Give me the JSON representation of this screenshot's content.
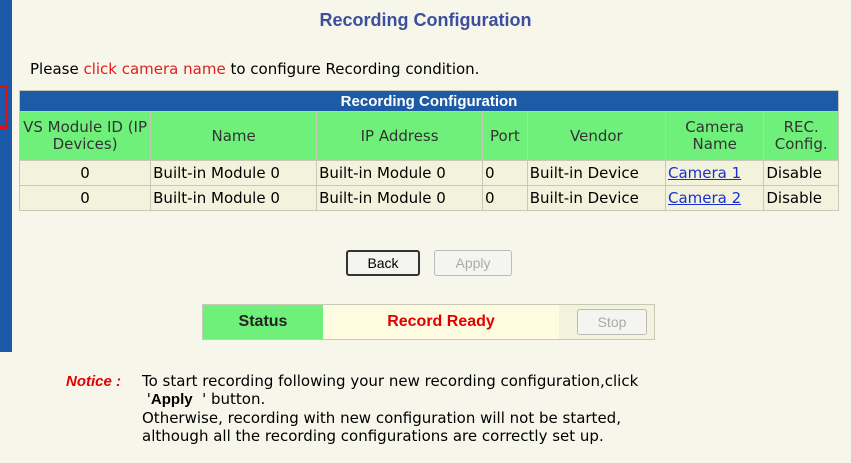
{
  "page": {
    "title": "Recording Configuration",
    "intro_before": "Please ",
    "intro_link": "click camera name",
    "intro_after": " to configure Recording condition."
  },
  "table": {
    "title": "Recording Configuration",
    "headers": [
      "VS Module ID (IP Devices)",
      "Name",
      "IP Address",
      "Port",
      "Vendor",
      "Camera Name",
      "REC. Config."
    ],
    "rows": [
      {
        "id": "0",
        "name": "Built-in Module 0",
        "ip": "Built-in Module 0",
        "port": "0",
        "vendor": "Built-in Device",
        "camera": "Camera 1",
        "rec": "Disable"
      },
      {
        "id": "0",
        "name": "Built-in Module 0",
        "ip": "Built-in Module 0",
        "port": "0",
        "vendor": "Built-in Device",
        "camera": "Camera 2",
        "rec": "Disable"
      }
    ]
  },
  "buttons": {
    "back": "Back",
    "apply": "Apply",
    "stop": "Stop"
  },
  "status": {
    "label": "Status",
    "value": "Record Ready"
  },
  "notice": {
    "label": "Notice :",
    "line1": "To start recording following your new recording configuration,click",
    "line2_pre": "'",
    "line2_bold": "Apply",
    "line2_post": "  ' button.",
    "line3": "Otherwise, recording with new configuration will not be started,",
    "line4": "although all the recording configurations are correctly set up."
  },
  "colors": {
    "accent_blue": "#1e5ba6",
    "header_green": "#6ff07a",
    "status_red": "#e00000"
  }
}
